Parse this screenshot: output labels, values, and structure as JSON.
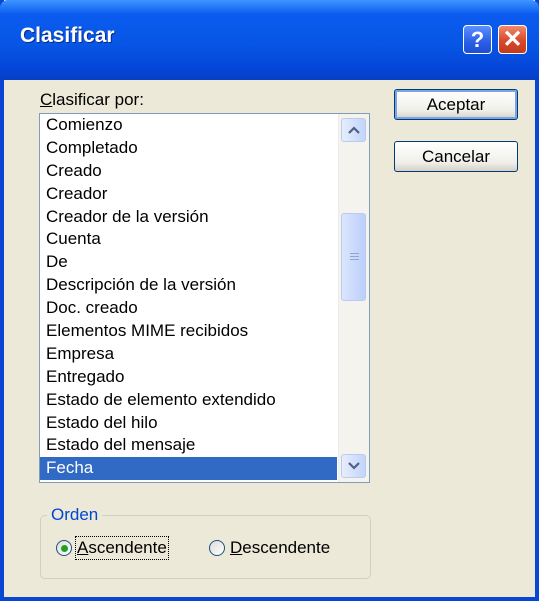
{
  "window": {
    "title": "Clasificar"
  },
  "titlebar_buttons": {
    "help": "?",
    "close": "✕"
  },
  "sort_by": {
    "label_underlined": "C",
    "label_rest": "lasificar por:",
    "items": [
      "Comienzo",
      "Completado",
      "Creado",
      "Creador",
      "Creador de la versión",
      "Cuenta",
      "De",
      "Descripción de la versión",
      "Doc. creado",
      "Elementos MIME recibidos",
      "Empresa",
      "Entregado",
      "Estado de elemento extendido",
      "Estado del hilo",
      "Estado del mensaje",
      "Fecha"
    ],
    "selected": "Fecha"
  },
  "scrollbar": {
    "up_icon": "chevron-up",
    "down_icon": "chevron-down"
  },
  "buttons": {
    "ok": "Aceptar",
    "cancel": "Cancelar"
  },
  "order": {
    "legend": "Orden",
    "ascending": {
      "underlined": "A",
      "rest": "scendente",
      "checked": true
    },
    "descending": {
      "underlined": "D",
      "rest": "escendente",
      "checked": false
    }
  },
  "colors": {
    "titlebar": "#0a5bf0",
    "selection": "#316ac5",
    "group_legend": "#0046d5"
  }
}
